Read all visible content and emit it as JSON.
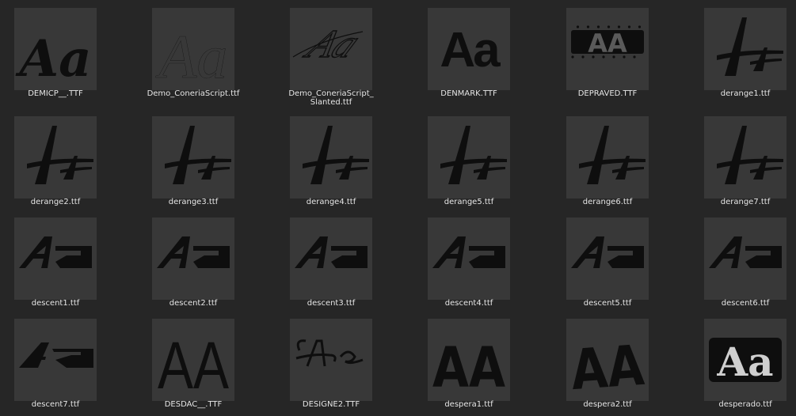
{
  "colors": {
    "background": "#262626",
    "thumbnail": "#383838",
    "glyph": "#0e0e0e",
    "label": "#e6e6e6"
  },
  "files": [
    {
      "name": "DEMICP__.TTF",
      "preview_style": "bold-script"
    },
    {
      "name": "Demo_ConeriaScript.ttf",
      "preview_style": "thin-script"
    },
    {
      "name": "Demo_ConeriaScript_\nSlanted.ttf",
      "preview_style": "slanted-thin-script"
    },
    {
      "name": "DENMARK.TTF",
      "preview_style": "heavy-sans"
    },
    {
      "name": "DEPRAVED.TTF",
      "preview_style": "grunge-caps"
    },
    {
      "name": "derange1.ttf",
      "preview_style": "brush-caps"
    },
    {
      "name": "derange2.ttf",
      "preview_style": "brush-caps"
    },
    {
      "name": "derange3.ttf",
      "preview_style": "brush-caps"
    },
    {
      "name": "derange4.ttf",
      "preview_style": "brush-caps"
    },
    {
      "name": "derange5.ttf",
      "preview_style": "brush-caps"
    },
    {
      "name": "derange6.ttf",
      "preview_style": "brush-caps"
    },
    {
      "name": "derange7.ttf",
      "preview_style": "brush-caps"
    },
    {
      "name": "descent1.ttf",
      "preview_style": "angular"
    },
    {
      "name": "descent2.ttf",
      "preview_style": "angular"
    },
    {
      "name": "descent3.ttf",
      "preview_style": "angular"
    },
    {
      "name": "descent4.ttf",
      "preview_style": "angular"
    },
    {
      "name": "descent5.ttf",
      "preview_style": "angular"
    },
    {
      "name": "descent6.ttf",
      "preview_style": "angular"
    },
    {
      "name": "descent7.ttf",
      "preview_style": "angular-thin"
    },
    {
      "name": "DESDAC__.TTF",
      "preview_style": "condensed-caps"
    },
    {
      "name": "DESIGNE2.TTF",
      "preview_style": "calligraphic"
    },
    {
      "name": "despera1.ttf",
      "preview_style": "rough-caps"
    },
    {
      "name": "despera2.ttf",
      "preview_style": "rough-caps"
    },
    {
      "name": "desperado.ttf",
      "preview_style": "outlined-western"
    }
  ],
  "preview_text": "Aa"
}
